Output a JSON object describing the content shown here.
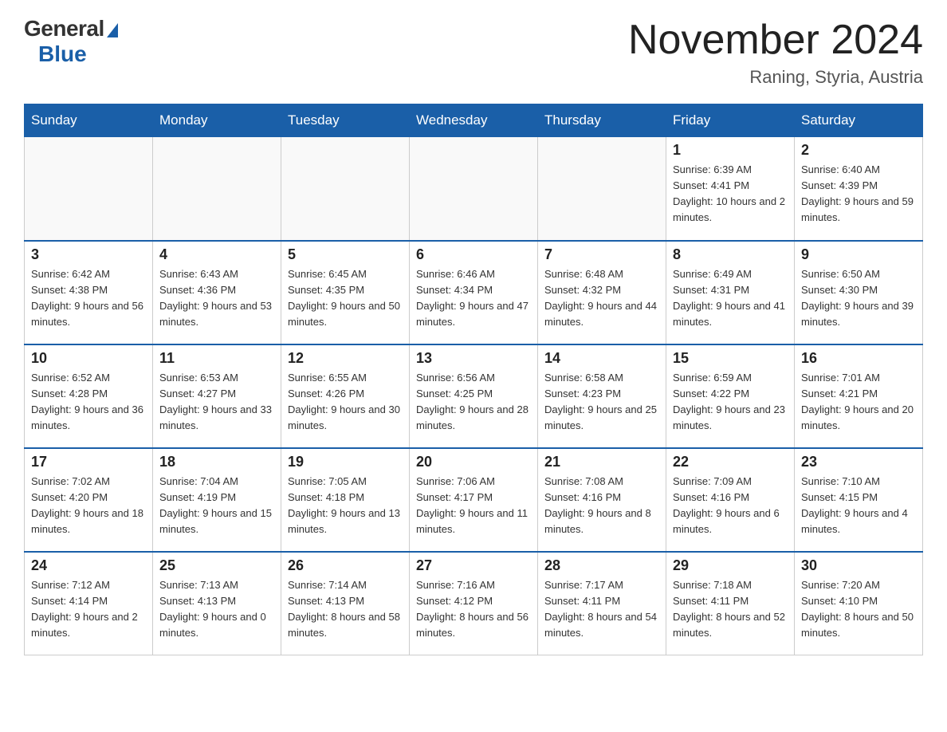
{
  "header": {
    "logo_general": "General",
    "logo_blue": "Blue",
    "month_year": "November 2024",
    "location": "Raning, Styria, Austria"
  },
  "weekdays": [
    "Sunday",
    "Monday",
    "Tuesday",
    "Wednesday",
    "Thursday",
    "Friday",
    "Saturday"
  ],
  "weeks": [
    [
      {
        "day": "",
        "info": ""
      },
      {
        "day": "",
        "info": ""
      },
      {
        "day": "",
        "info": ""
      },
      {
        "day": "",
        "info": ""
      },
      {
        "day": "",
        "info": ""
      },
      {
        "day": "1",
        "info": "Sunrise: 6:39 AM\nSunset: 4:41 PM\nDaylight: 10 hours and 2 minutes."
      },
      {
        "day": "2",
        "info": "Sunrise: 6:40 AM\nSunset: 4:39 PM\nDaylight: 9 hours and 59 minutes."
      }
    ],
    [
      {
        "day": "3",
        "info": "Sunrise: 6:42 AM\nSunset: 4:38 PM\nDaylight: 9 hours and 56 minutes."
      },
      {
        "day": "4",
        "info": "Sunrise: 6:43 AM\nSunset: 4:36 PM\nDaylight: 9 hours and 53 minutes."
      },
      {
        "day": "5",
        "info": "Sunrise: 6:45 AM\nSunset: 4:35 PM\nDaylight: 9 hours and 50 minutes."
      },
      {
        "day": "6",
        "info": "Sunrise: 6:46 AM\nSunset: 4:34 PM\nDaylight: 9 hours and 47 minutes."
      },
      {
        "day": "7",
        "info": "Sunrise: 6:48 AM\nSunset: 4:32 PM\nDaylight: 9 hours and 44 minutes."
      },
      {
        "day": "8",
        "info": "Sunrise: 6:49 AM\nSunset: 4:31 PM\nDaylight: 9 hours and 41 minutes."
      },
      {
        "day": "9",
        "info": "Sunrise: 6:50 AM\nSunset: 4:30 PM\nDaylight: 9 hours and 39 minutes."
      }
    ],
    [
      {
        "day": "10",
        "info": "Sunrise: 6:52 AM\nSunset: 4:28 PM\nDaylight: 9 hours and 36 minutes."
      },
      {
        "day": "11",
        "info": "Sunrise: 6:53 AM\nSunset: 4:27 PM\nDaylight: 9 hours and 33 minutes."
      },
      {
        "day": "12",
        "info": "Sunrise: 6:55 AM\nSunset: 4:26 PM\nDaylight: 9 hours and 30 minutes."
      },
      {
        "day": "13",
        "info": "Sunrise: 6:56 AM\nSunset: 4:25 PM\nDaylight: 9 hours and 28 minutes."
      },
      {
        "day": "14",
        "info": "Sunrise: 6:58 AM\nSunset: 4:23 PM\nDaylight: 9 hours and 25 minutes."
      },
      {
        "day": "15",
        "info": "Sunrise: 6:59 AM\nSunset: 4:22 PM\nDaylight: 9 hours and 23 minutes."
      },
      {
        "day": "16",
        "info": "Sunrise: 7:01 AM\nSunset: 4:21 PM\nDaylight: 9 hours and 20 minutes."
      }
    ],
    [
      {
        "day": "17",
        "info": "Sunrise: 7:02 AM\nSunset: 4:20 PM\nDaylight: 9 hours and 18 minutes."
      },
      {
        "day": "18",
        "info": "Sunrise: 7:04 AM\nSunset: 4:19 PM\nDaylight: 9 hours and 15 minutes."
      },
      {
        "day": "19",
        "info": "Sunrise: 7:05 AM\nSunset: 4:18 PM\nDaylight: 9 hours and 13 minutes."
      },
      {
        "day": "20",
        "info": "Sunrise: 7:06 AM\nSunset: 4:17 PM\nDaylight: 9 hours and 11 minutes."
      },
      {
        "day": "21",
        "info": "Sunrise: 7:08 AM\nSunset: 4:16 PM\nDaylight: 9 hours and 8 minutes."
      },
      {
        "day": "22",
        "info": "Sunrise: 7:09 AM\nSunset: 4:16 PM\nDaylight: 9 hours and 6 minutes."
      },
      {
        "day": "23",
        "info": "Sunrise: 7:10 AM\nSunset: 4:15 PM\nDaylight: 9 hours and 4 minutes."
      }
    ],
    [
      {
        "day": "24",
        "info": "Sunrise: 7:12 AM\nSunset: 4:14 PM\nDaylight: 9 hours and 2 minutes."
      },
      {
        "day": "25",
        "info": "Sunrise: 7:13 AM\nSunset: 4:13 PM\nDaylight: 9 hours and 0 minutes."
      },
      {
        "day": "26",
        "info": "Sunrise: 7:14 AM\nSunset: 4:13 PM\nDaylight: 8 hours and 58 minutes."
      },
      {
        "day": "27",
        "info": "Sunrise: 7:16 AM\nSunset: 4:12 PM\nDaylight: 8 hours and 56 minutes."
      },
      {
        "day": "28",
        "info": "Sunrise: 7:17 AM\nSunset: 4:11 PM\nDaylight: 8 hours and 54 minutes."
      },
      {
        "day": "29",
        "info": "Sunrise: 7:18 AM\nSunset: 4:11 PM\nDaylight: 8 hours and 52 minutes."
      },
      {
        "day": "30",
        "info": "Sunrise: 7:20 AM\nSunset: 4:10 PM\nDaylight: 8 hours and 50 minutes."
      }
    ]
  ]
}
